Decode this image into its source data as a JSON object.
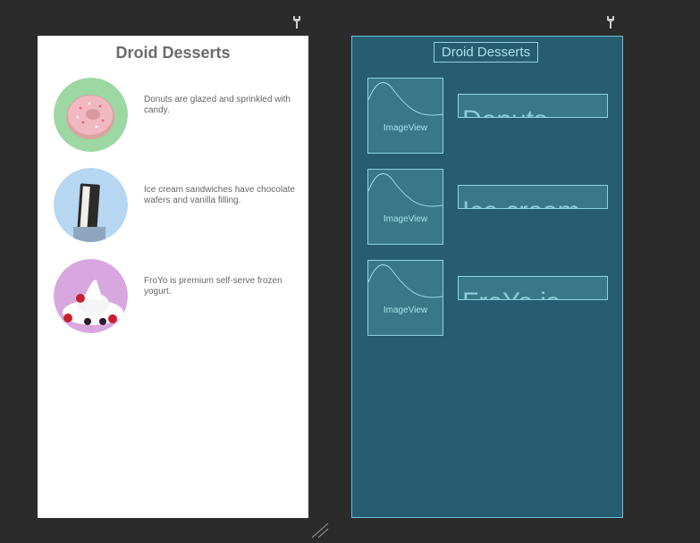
{
  "app": {
    "title": "Droid Desserts"
  },
  "items": [
    {
      "text": "Donuts are glazed and sprinkled with candy.",
      "image": "donut-image",
      "blueprint_text": "Donuts"
    },
    {
      "text": "Ice cream sandwiches have chocolate wafers and vanilla filling.",
      "image": "ice-cream-sandwich-image",
      "blueprint_text": "Ice cream"
    },
    {
      "text": "FroYo is premium self-serve frozen yogurt.",
      "image": "froyo-image",
      "blueprint_text": "FroYo is"
    }
  ],
  "blueprint": {
    "image_label": "ImageView"
  },
  "colors": {
    "canvas_bg": "#2b2b2c",
    "blueprint_bg": "#275d70",
    "blueprint_line": "#8fd2dd"
  },
  "icons": {
    "pin": "wrench-pin-icon",
    "resize": "resize-handle-icon"
  }
}
